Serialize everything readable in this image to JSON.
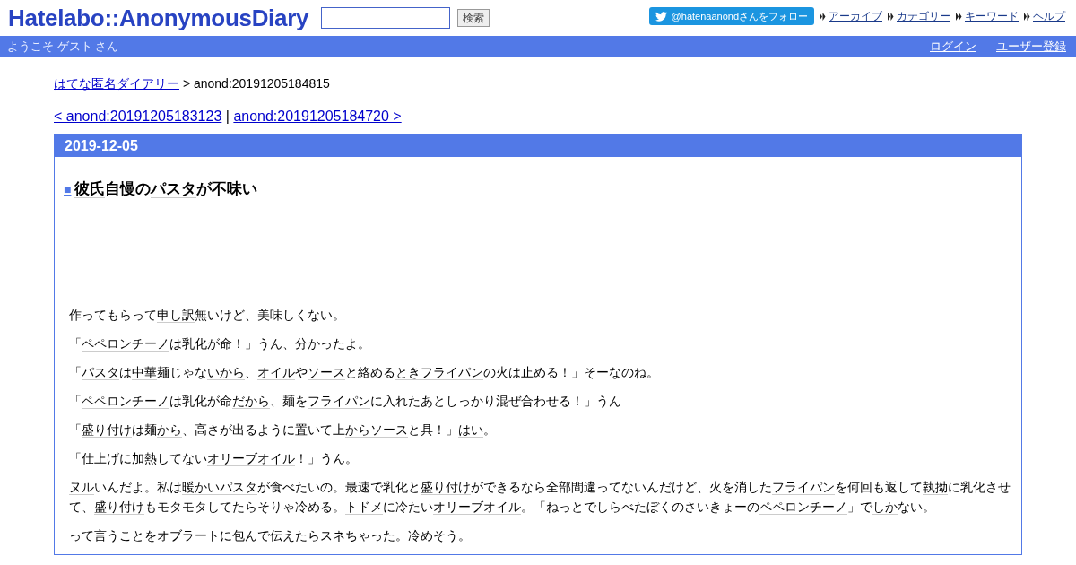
{
  "header": {
    "logo": "Hatelabo::AnonymousDiary",
    "search": {
      "button": "検索"
    },
    "follow_button": "@hatenaanondさんをフォロー",
    "links": [
      "アーカイブ",
      "カテゴリー",
      "キーワード",
      "ヘルプ"
    ]
  },
  "user_bar": {
    "greeting": "ようこそ ゲスト さん",
    "links": [
      "ログイン",
      "ユーザー登録"
    ]
  },
  "breadcrumb": {
    "link": "はてな匿名ダイアリー",
    "current": "> anond:20191205184815"
  },
  "pager": {
    "prev": "< anond:20191205183123",
    "separator": "|",
    "next": "anond:20191205184720 >"
  },
  "day": {
    "date": "2019-12-05",
    "entry": {
      "marker": "■",
      "title": [
        {
          "kind": "keyword",
          "text": "彼氏"
        },
        {
          "kind": "text",
          "text": "自慢の"
        },
        {
          "kind": "keyword",
          "text": "パスタ"
        },
        {
          "kind": "text",
          "text": "が不味い"
        }
      ],
      "paragraphs": [
        [
          {
            "kind": "text",
            "text": "作ってもらって"
          },
          {
            "kind": "keyword",
            "text": "申し訳"
          },
          {
            "kind": "text",
            "text": "無いけど、美味しくない。"
          }
        ],
        [
          {
            "kind": "text",
            "text": "「"
          },
          {
            "kind": "keyword",
            "text": "ペペロンチーノ"
          },
          {
            "kind": "text",
            "text": "は乳化が命！」うん、分かったよ。"
          }
        ],
        [
          {
            "kind": "text",
            "text": "「"
          },
          {
            "kind": "keyword",
            "text": "パスタ"
          },
          {
            "kind": "text",
            "text": "は"
          },
          {
            "kind": "keyword",
            "text": "中華"
          },
          {
            "kind": "text",
            "text": "麺じゃな"
          },
          {
            "kind": "keyword",
            "text": "いから"
          },
          {
            "kind": "text",
            "text": "、"
          },
          {
            "kind": "keyword",
            "text": "オイル"
          },
          {
            "kind": "text",
            "text": "や"
          },
          {
            "kind": "keyword",
            "text": "ソース"
          },
          {
            "kind": "text",
            "text": "と絡める"
          },
          {
            "kind": "keyword",
            "text": "とき"
          },
          {
            "kind": "keyword",
            "text": "フライパン"
          },
          {
            "kind": "text",
            "text": "の火は止める！」そーなのね。"
          }
        ],
        [
          {
            "kind": "text",
            "text": "「"
          },
          {
            "kind": "keyword",
            "text": "ペペロンチーノ"
          },
          {
            "kind": "text",
            "text": "は乳化が命"
          },
          {
            "kind": "keyword",
            "text": "だから"
          },
          {
            "kind": "text",
            "text": "、麺を"
          },
          {
            "kind": "keyword",
            "text": "フライパン"
          },
          {
            "kind": "text",
            "text": "に入れたあとしっかり混ぜ合わせる！」うん"
          }
        ],
        [
          {
            "kind": "text",
            "text": "「"
          },
          {
            "kind": "keyword",
            "text": "盛り付け"
          },
          {
            "kind": "text",
            "text": "は麺"
          },
          {
            "kind": "keyword",
            "text": "から"
          },
          {
            "kind": "text",
            "text": "、高さが出るように置いて上"
          },
          {
            "kind": "keyword",
            "text": "から"
          },
          {
            "kind": "keyword",
            "text": "ソース"
          },
          {
            "kind": "text",
            "text": "と具！」"
          },
          {
            "kind": "keyword",
            "text": "はい"
          },
          {
            "kind": "text",
            "text": "。"
          }
        ],
        [
          {
            "kind": "text",
            "text": "「仕上げに加熱してない"
          },
          {
            "kind": "keyword",
            "text": "オリーブオイル"
          },
          {
            "kind": "text",
            "text": "！」うん。"
          }
        ],
        [
          {
            "kind": "keyword",
            "text": "ヌル"
          },
          {
            "kind": "text",
            "text": "いんだよ。私は"
          },
          {
            "kind": "keyword",
            "text": "暖かいパスタ"
          },
          {
            "kind": "text",
            "text": "が食べたいの。最速で乳化と"
          },
          {
            "kind": "keyword",
            "text": "盛り付け"
          },
          {
            "kind": "text",
            "text": "ができるなら全部間違ってないんだけど、火を消した"
          },
          {
            "kind": "keyword",
            "text": "フライパン"
          },
          {
            "kind": "text",
            "text": "を何回も返して"
          },
          {
            "kind": "keyword",
            "text": "執拗"
          },
          {
            "kind": "text",
            "text": "に乳化させて、"
          },
          {
            "kind": "keyword",
            "text": "盛り付け"
          },
          {
            "kind": "text",
            "text": "もモタモタしてたらそりゃ冷める。"
          },
          {
            "kind": "keyword",
            "text": "トドメ"
          },
          {
            "kind": "text",
            "text": "に冷たい"
          },
          {
            "kind": "keyword",
            "text": "オリーブオイル"
          },
          {
            "kind": "text",
            "text": "。「ねっとでしらべたぼくのさいきょーの"
          },
          {
            "kind": "keyword",
            "text": "ペペロンチーノ"
          },
          {
            "kind": "text",
            "text": "」で"
          },
          {
            "kind": "keyword",
            "text": "しか"
          },
          {
            "kind": "text",
            "text": "ない。"
          }
        ],
        [
          {
            "kind": "text",
            "text": "って言うことを"
          },
          {
            "kind": "keyword",
            "text": "オブラート"
          },
          {
            "kind": "text",
            "text": "に包んで伝えたらスネちゃった。冷めそう。"
          }
        ]
      ]
    }
  }
}
